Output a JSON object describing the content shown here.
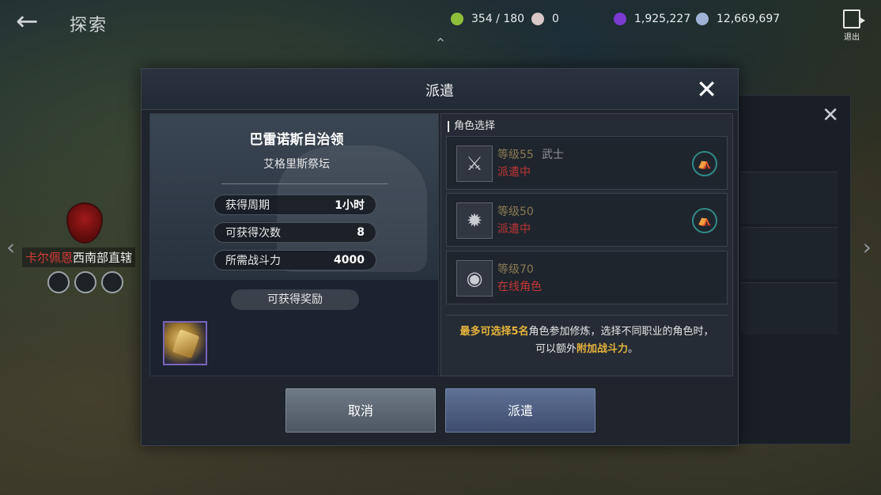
{
  "top_bar": {
    "title": "探索",
    "back_icon": "back-arrow-icon",
    "currencies": [
      {
        "icon": "energy-icon",
        "value": "354 / 180",
        "color": "#8fbf3a"
      },
      {
        "icon": "pearl-icon",
        "value": "0",
        "color": "#d9c6c6"
      },
      {
        "icon": "purple-gem-icon",
        "value": "1,925,227",
        "color": "#7a3bd1"
      },
      {
        "icon": "silver-coin-icon",
        "value": "12,669,697",
        "color": "#9fb3d6"
      }
    ],
    "exit_label": "退出"
  },
  "map": {
    "region_red": "卡尔佩恩",
    "region_white": "西南部直辖"
  },
  "dialog": {
    "title": "派遣",
    "close_icon": "close-icon",
    "region_name": "巴雷诺斯自治领",
    "region_sub": "艾格里斯祭坛",
    "stats": [
      {
        "label": "获得周期",
        "value": "1小时"
      },
      {
        "label": "可获得次数",
        "value": "8"
      },
      {
        "label": "所需战斗力",
        "value": "4000"
      }
    ],
    "reward_button": "可获得奖励",
    "reward_item_icon": "gold-crystal-icon",
    "character_section_title": "角色选择",
    "characters": [
      {
        "level": "等级55",
        "job": "武士",
        "status": "派遣中",
        "portrait": "crossed-swords-icon",
        "badge": "dispatch-icon"
      },
      {
        "level": "等级50",
        "job": "",
        "status": "派遣中",
        "portrait": "claw-icon",
        "badge": "dispatch-icon"
      },
      {
        "level": "等级70",
        "job": "",
        "status": "在线角色",
        "portrait": "orb-icon",
        "badge": ""
      }
    ],
    "info": {
      "line1_hl": "最多可选择5名",
      "line1_rest": "角色参加修炼，选择不同职业的角色时，",
      "line2_pre": "可以额外",
      "line2_hl": "附加战斗力",
      "line2_end": "。"
    },
    "cancel_label": "取消",
    "confirm_label": "派遣"
  },
  "colors": {
    "accent_gold": "#e5b43c",
    "status_red": "#c23636",
    "badge_teal": "#2f8a86"
  }
}
